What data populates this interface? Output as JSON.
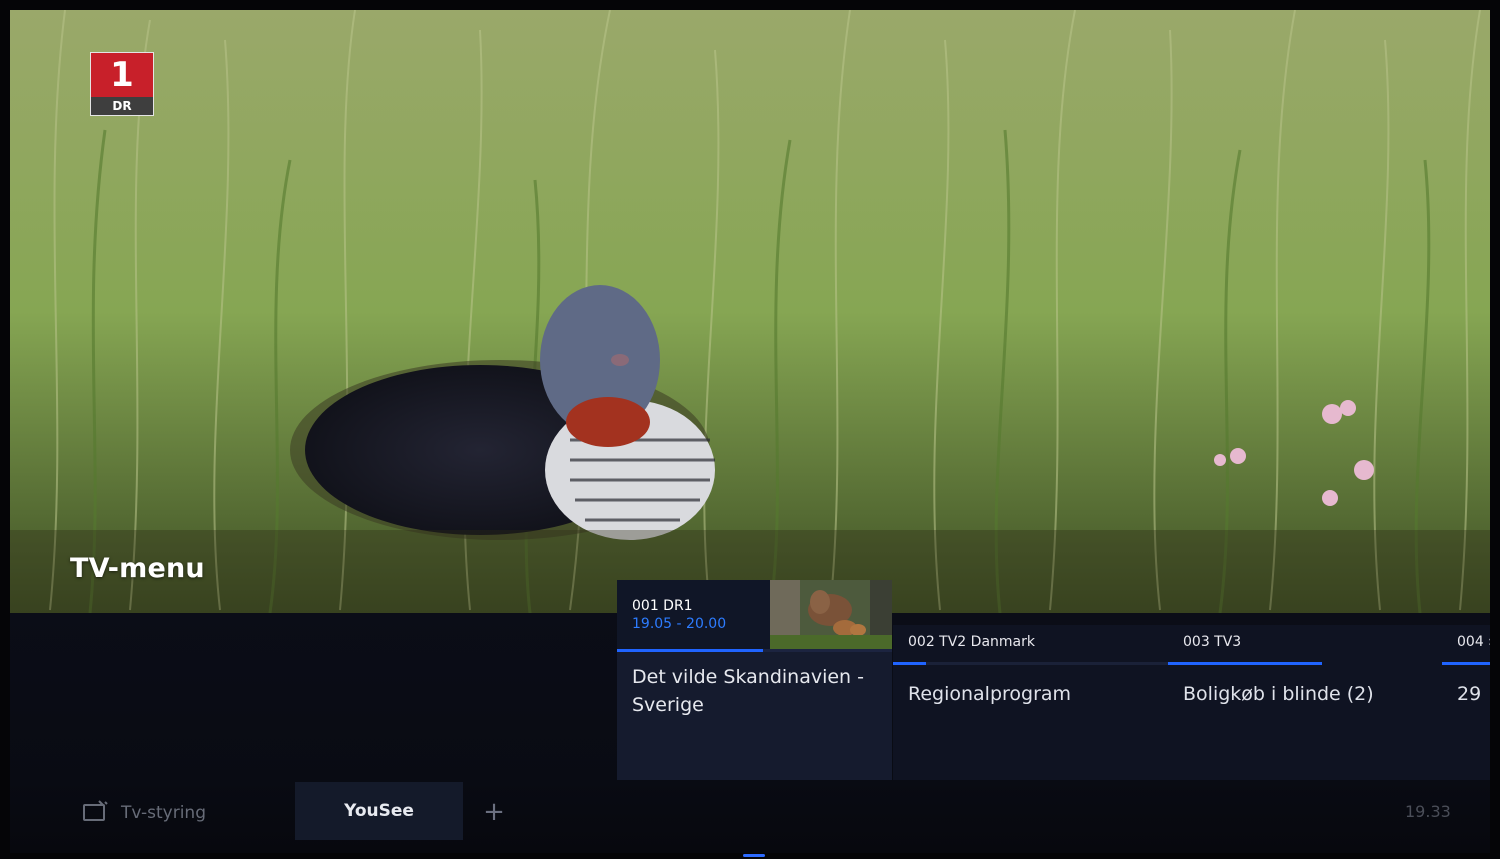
{
  "channel_logo": {
    "number": "1",
    "network": "DR"
  },
  "overlay_title": "TV-menu",
  "channels": [
    {
      "channel": "001 DR1",
      "time": "19.05 - 20.00",
      "program": "Det vilde Skandinavien - Sverige",
      "progress": 0.53,
      "selected": true
    },
    {
      "channel": "002 TV2 Danmark",
      "program": "Regionalprogram",
      "progress": 0.12
    },
    {
      "channel": "003 TV3",
      "program": "Boligkøb i blinde (2)",
      "progress": 1.0
    },
    {
      "channel": "004 ›",
      "program": "29",
      "progress": 1.0
    }
  ],
  "bottom_tabs": {
    "tv_control_label": "Tv-styring",
    "provider_label": "YouSee",
    "add_label": "+"
  },
  "clock": "19.33",
  "colors": {
    "accent": "#2064ff",
    "time_text": "#2d7cff",
    "logo_red": "#c8202a"
  }
}
